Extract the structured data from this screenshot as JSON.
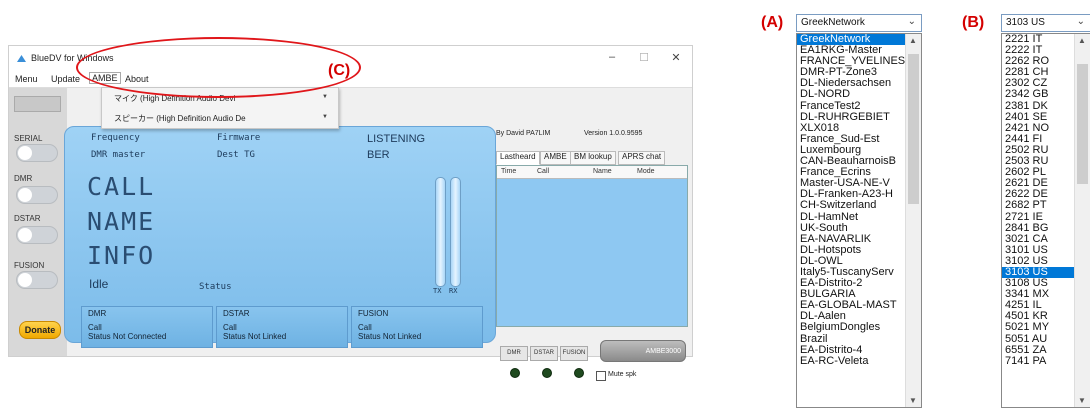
{
  "window": {
    "title": "BlueDV for Windows",
    "menu": [
      "Menu",
      "Update",
      "AMBE",
      "About"
    ],
    "ambe_dropdown": [
      "マイク (High Definition Audio Devi",
      "スピーカー (High Definition Audio De"
    ]
  },
  "left_panel": {
    "labels": [
      "SERIAL",
      "DMR",
      "DSTAR",
      "FUSION"
    ],
    "donate": "Donate"
  },
  "lcd": {
    "frequency": "Frequency",
    "firmware": "Firmware",
    "listening": "LISTENING",
    "dmr_master": "DMR master",
    "dest_tg": "Dest TG",
    "ber": "BER",
    "call": "CALL",
    "name": "NAME",
    "info": "INFO",
    "idle": "Idle",
    "status": "Status",
    "tx": "TX",
    "rx": "RX"
  },
  "status_boxes": [
    {
      "header": "DMR",
      "call": "Call",
      "status": "Status  Not Connected"
    },
    {
      "header": "DSTAR",
      "call": "Call",
      "status": "Status  Not Linked"
    },
    {
      "header": "FUSION",
      "call": "Call",
      "status": "Status  Not Linked"
    }
  ],
  "right_panel": {
    "author": "By David PA7LIM",
    "version": "Version 1.0.0.9595",
    "tabs": [
      "Lastheard",
      "AMBE",
      "BM lookup",
      "APRS chat"
    ],
    "columns": [
      "Time",
      "Call",
      "Name",
      "Mode"
    ],
    "mode_buttons": [
      "DMR",
      "DSTAR",
      "FUSION"
    ],
    "ambe3000": "AMBE3000",
    "mute": "Mute spk"
  },
  "annotations": {
    "a": "(A)",
    "b": "(B)",
    "c": "(C)"
  },
  "list_a": {
    "combo_value": "GreekNetwork",
    "items": [
      "GreekNetwork",
      "EA1RKG-Master",
      "FRANCE_YVELINES",
      "DMR-PT-Zone3",
      "DL-Niedersachsen",
      "DL-NORD",
      "FranceTest2",
      "DL-RUHRGEBIET",
      "XLX018",
      "France_Sud-Est",
      "Luxembourg",
      "CAN-BeauharnoisB",
      "France_Ecrins",
      "Master-USA-NE-V",
      "DL-Franken-A23-H",
      "CH-Switzerland",
      "DL-HamNet",
      "UK-South",
      "EA-NAVARLIK",
      "DL-Hotspots",
      "DL-OWL",
      "Italy5-TuscanyServ",
      "EA-Distrito-2",
      "BULGARIA",
      "EA-GLOBAL-MAST",
      "DL-Aalen",
      "BelgiumDongles",
      "Brazil",
      "EA-Distrito-4",
      "EA-RC-Veleta"
    ],
    "selected_index": 0
  },
  "list_b": {
    "combo_value": "3103  US",
    "items": [
      "2221  IT",
      "2222  IT",
      "2262  RO",
      "2281  CH",
      "2302  CZ",
      "2342  GB",
      "2381  DK",
      "2401  SE",
      "2421  NO",
      "2441  FI",
      "2502  RU",
      "2503  RU",
      "2602  PL",
      "2621  DE",
      "2622  DE",
      "2682  PT",
      "2721  IE",
      "2841  BG",
      "3021  CA",
      "3101  US",
      "3102  US",
      "3103  US",
      "3108  US",
      "3341  MX",
      "4251  IL",
      "4501  KR",
      "5021  MY",
      "5051  AU",
      "6551  ZA",
      "7141  PA"
    ],
    "selected_index": 21
  },
  "colors": {
    "annotation": "#d40000",
    "selection": "#0078d7",
    "lcd": "#8ec8f2"
  }
}
